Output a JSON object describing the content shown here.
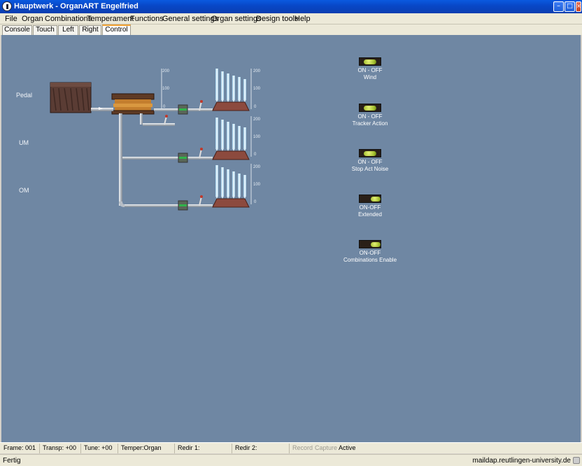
{
  "window": {
    "title": "Hauptwerk - OrganART Engelfried"
  },
  "menubar": {
    "items": [
      {
        "label": "File"
      },
      {
        "label": "Organ"
      },
      {
        "label": "Combinations"
      },
      {
        "label": "Temperament"
      },
      {
        "label": "Functions"
      },
      {
        "label": "General settings"
      },
      {
        "label": "Organ settings"
      },
      {
        "label": "Design tools"
      },
      {
        "label": "Help"
      }
    ]
  },
  "tabs": [
    {
      "label": "Console"
    },
    {
      "label": "Touch"
    },
    {
      "label": "Left"
    },
    {
      "label": "Right"
    },
    {
      "label": "Control",
      "active": true
    }
  ],
  "divisions": [
    {
      "label": "Pedal"
    },
    {
      "label": "UM"
    },
    {
      "label": "OM"
    }
  ],
  "gauge_scale": {
    "max": "200",
    "mid": "100",
    "min": "0"
  },
  "toggles": [
    {
      "state": "ON - OFF",
      "name": "Wind",
      "on": true
    },
    {
      "state": "ON - OFF",
      "name": "Tracker Action",
      "on": true
    },
    {
      "state": "ON - OFF",
      "name": "Stop Act Noise",
      "on": true
    },
    {
      "state": "ON-OFF",
      "name": "Extended",
      "on": false
    },
    {
      "state": "ON-OFF",
      "name": "Combinations Enable",
      "on": false
    }
  ],
  "statusbar": {
    "frame": "Frame: 001",
    "transp": "Transp: +00",
    "tune": "Tune: +00",
    "temper": "Temper:Organ",
    "redir1": "Redir 1:",
    "redir2": "Redir 2:",
    "record": "Record",
    "capture": "Capture",
    "active": "Active"
  },
  "taskbar": {
    "status": "Fertig",
    "host": "maildap.reutlingen-university.de"
  },
  "colors": {
    "stage": "#6f87a3",
    "titlebar": "#0a4ed0",
    "lamp_on": "#c6da48"
  }
}
